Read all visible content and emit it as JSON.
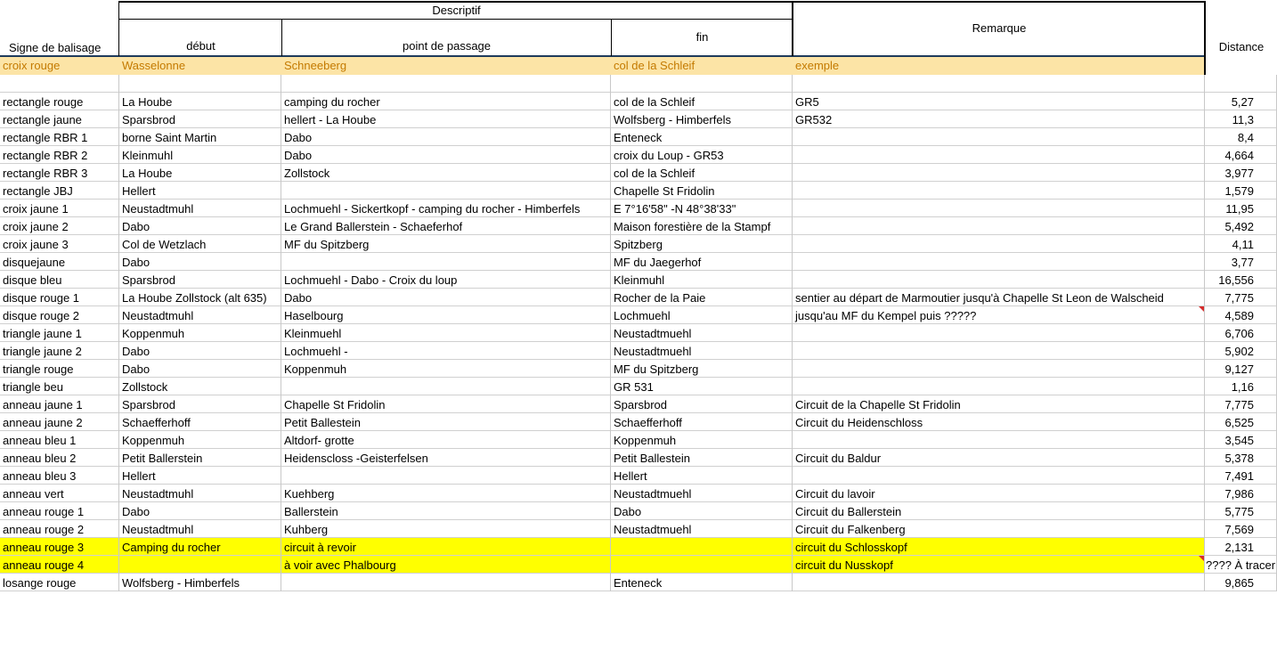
{
  "header": {
    "group_label": "Descriptif",
    "col_signe": "Signe de balisage",
    "col_debut": "début",
    "col_point": "point de passage",
    "col_fin": "fin",
    "col_remarque": "Remarque",
    "col_distance": "Distance"
  },
  "example_row": {
    "signe": "croix rouge",
    "debut": "Wasselonne",
    "point": "Schneeberg",
    "fin": "col de la Schleif",
    "remarque": "exemple"
  },
  "rows": [
    {
      "signe": "rectangle rouge",
      "debut": "La Hoube",
      "point": "camping du rocher",
      "fin": "col de la Schleif",
      "remarque": "GR5",
      "distance": "5,27"
    },
    {
      "signe": "rectangle jaune",
      "debut": "Sparsbrod",
      "point": "hellert  -  La Hoube",
      "fin": "Wolfsberg - Himberfels",
      "remarque": "GR532",
      "distance": "11,3"
    },
    {
      "signe": "rectangle RBR 1",
      "debut": "borne Saint Martin",
      "point": "Dabo",
      "fin": "Enteneck",
      "remarque": "",
      "distance": "8,4"
    },
    {
      "signe": "rectangle RBR 2",
      "debut": "Kleinmuhl",
      "point": "Dabo",
      "fin": "croix du Loup - GR53",
      "remarque": "",
      "distance": "4,664"
    },
    {
      "signe": "rectangle RBR 3",
      "debut": "La Hoube",
      "point": "Zollstock",
      "fin": "col de la Schleif",
      "remarque": "",
      "distance": "3,977"
    },
    {
      "signe": "rectangle JBJ",
      "debut": "Hellert",
      "point": "",
      "fin": "Chapelle St Fridolin",
      "remarque": "",
      "distance": "1,579"
    },
    {
      "signe": "croix jaune 1",
      "debut": "Neustadtmuhl",
      "point": "Lochmuehl - Sickertkopf - camping du rocher - Himberfels",
      "fin": "E 7°16'58\" -N 48°38'33\"",
      "remarque": "",
      "distance": "11,95"
    },
    {
      "signe": "croix jaune 2",
      "debut": "Dabo",
      "point": "Le Grand Ballerstein - Schaeferhof",
      "fin": "Maison forestière de la Stampf",
      "remarque": "",
      "distance": "5,492"
    },
    {
      "signe": "croix jaune 3",
      "debut": "Col de Wetzlach",
      "point": "MF du Spitzberg",
      "fin": "Spitzberg",
      "remarque": "",
      "distance": "4,11"
    },
    {
      "signe": "disquejaune",
      "debut": "Dabo",
      "point": "",
      "fin": "MF du Jaegerhof",
      "remarque": "",
      "distance": "3,77"
    },
    {
      "signe": "disque bleu",
      "debut": "Sparsbrod",
      "point": "Lochmuehl - Dabo - Croix du loup",
      "fin": "Kleinmuhl",
      "remarque": "",
      "distance": "16,556"
    },
    {
      "signe": "disque rouge 1",
      "debut": "La Hoube Zollstock (alt 635)",
      "point": "Dabo",
      "fin": "Rocher de la Paie",
      "remarque": "sentier au départ de Marmoutier jusqu'à Chapelle St Leon de Walscheid",
      "distance": "7,775"
    },
    {
      "signe": "disque rouge 2",
      "debut": "Neustadtmuhl",
      "point": "Haselbourg",
      "fin": "Lochmuehl",
      "remarque": "jusqu'au MF du Kempel puis ?????",
      "distance": "4,589"
    },
    {
      "signe": "triangle jaune 1",
      "debut": "Koppenmuh",
      "point": "Kleinmuehl",
      "fin": "Neustadtmuehl",
      "remarque": "",
      "distance": "6,706"
    },
    {
      "signe": "triangle jaune 2",
      "debut": "Dabo",
      "point": "Lochmuehl -",
      "fin": "Neustadtmuehl",
      "remarque": "",
      "distance": "5,902"
    },
    {
      "signe": "triangle rouge",
      "debut": "Dabo",
      "point": "Koppenmuh",
      "fin": "MF du Spitzberg",
      "remarque": "",
      "distance": "9,127"
    },
    {
      "signe": "triangle beu",
      "debut": "Zollstock",
      "point": "",
      "fin": "GR 531",
      "remarque": "",
      "distance": "1,16"
    },
    {
      "signe": "anneau jaune 1",
      "debut": "Sparsbrod",
      "point": "Chapelle St Fridolin",
      "fin": "Sparsbrod",
      "remarque": "Circuit de la Chapelle St Fridolin",
      "distance": "7,775"
    },
    {
      "signe": "anneau jaune 2",
      "debut": "Schaefferhoff",
      "point": "Petit Ballestein",
      "fin": "Schaefferhoff",
      "remarque": "Circuit du Heidenschloss",
      "distance": "6,525"
    },
    {
      "signe": "anneau bleu 1",
      "debut": "Koppenmuh",
      "point": "Altdorf- grotte",
      "fin": "Koppenmuh",
      "remarque": "",
      "distance": "3,545"
    },
    {
      "signe": "anneau bleu 2",
      "debut": "Petit Ballerstein",
      "point": "Heidenscloss -Geisterfelsen",
      "fin": "Petit Ballestein",
      "remarque": "Circuit du Baldur",
      "distance": "5,378"
    },
    {
      "signe": "anneau bleu 3",
      "debut": "Hellert",
      "point": "",
      "fin": "Hellert",
      "remarque": "",
      "distance": "7,491"
    },
    {
      "signe": "anneau vert",
      "debut": "Neustadtmuhl",
      "point": "Kuehberg",
      "fin": "Neustadtmuehl",
      "remarque": "Circuit du lavoir",
      "distance": "7,986"
    },
    {
      "signe": "anneau rouge 1",
      "debut": "Dabo",
      "point": "Ballerstein",
      "fin": "Dabo",
      "remarque": "Circuit du Ballerstein",
      "distance": "5,775"
    },
    {
      "signe": "anneau rouge 2",
      "debut": "Neustadtmuhl",
      "point": "Kuhberg",
      "fin": "Neustadtmuehl",
      "remarque": "Circuit du Falkenberg",
      "distance": "7,569"
    },
    {
      "signe": "anneau rouge 3",
      "debut": "Camping du rocher",
      "point": "circuit à revoir",
      "fin": "",
      "remarque": "circuit du Schlosskopf",
      "distance": "2,131",
      "highlight": true
    },
    {
      "signe": "anneau rouge 4",
      "debut": "",
      "point": "à voir avec Phalbourg",
      "fin": "",
      "remarque": "circuit du Nusskopf",
      "distance": "???? À tracer",
      "highlight": true
    },
    {
      "signe": "losange rouge",
      "debut": "Wolfsberg - Himberfels",
      "point": "",
      "fin": "Enteneck",
      "remarque": "",
      "distance": "9,865"
    }
  ],
  "colors": {
    "example_bg": "#fce4a6",
    "example_text": "#c47a00",
    "highlight": "#ffff00",
    "comment_marker": "#d62b2b"
  }
}
